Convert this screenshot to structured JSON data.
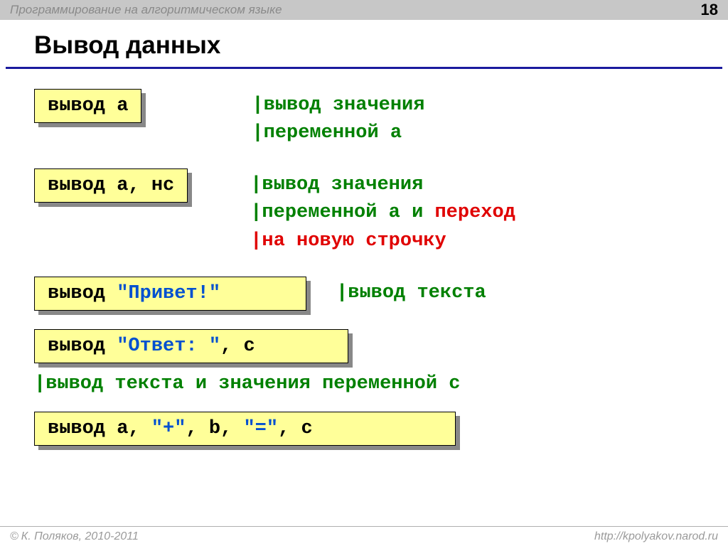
{
  "header": {
    "title": "Программирование на алгоритмическом языке",
    "page": "18"
  },
  "slide": {
    "title": "Вывод данных"
  },
  "row1": {
    "code": {
      "kw": "вывод ",
      "arg": "a"
    },
    "c1": "|вывод значения",
    "c2": "|переменной a"
  },
  "row2": {
    "code": {
      "kw": "вывод ",
      "arg": "a, нс"
    },
    "c1": "|вывод значения",
    "c2a": "|переменной a и ",
    "c2b": "переход",
    "c3": "|на новую строчку"
  },
  "row3": {
    "code": {
      "kw": "вывод ",
      "str": "\"Привет!\""
    },
    "c1": "|вывод текста"
  },
  "row4": {
    "code": {
      "kw": "вывод ",
      "str": "\"Ответ: \"",
      "rest": ", c"
    }
  },
  "fullcomment": "|вывод текста и значения переменной c",
  "row5": {
    "kw": "вывод ",
    "p1": "a, ",
    "s1": "\"+\"",
    "p2": ", b, ",
    "s2": "\"=\"",
    "p3": ", c"
  },
  "footer": {
    "copyright": " К. Поляков, 2010-2011",
    "url": "http://kpolyakov.narod.ru"
  }
}
